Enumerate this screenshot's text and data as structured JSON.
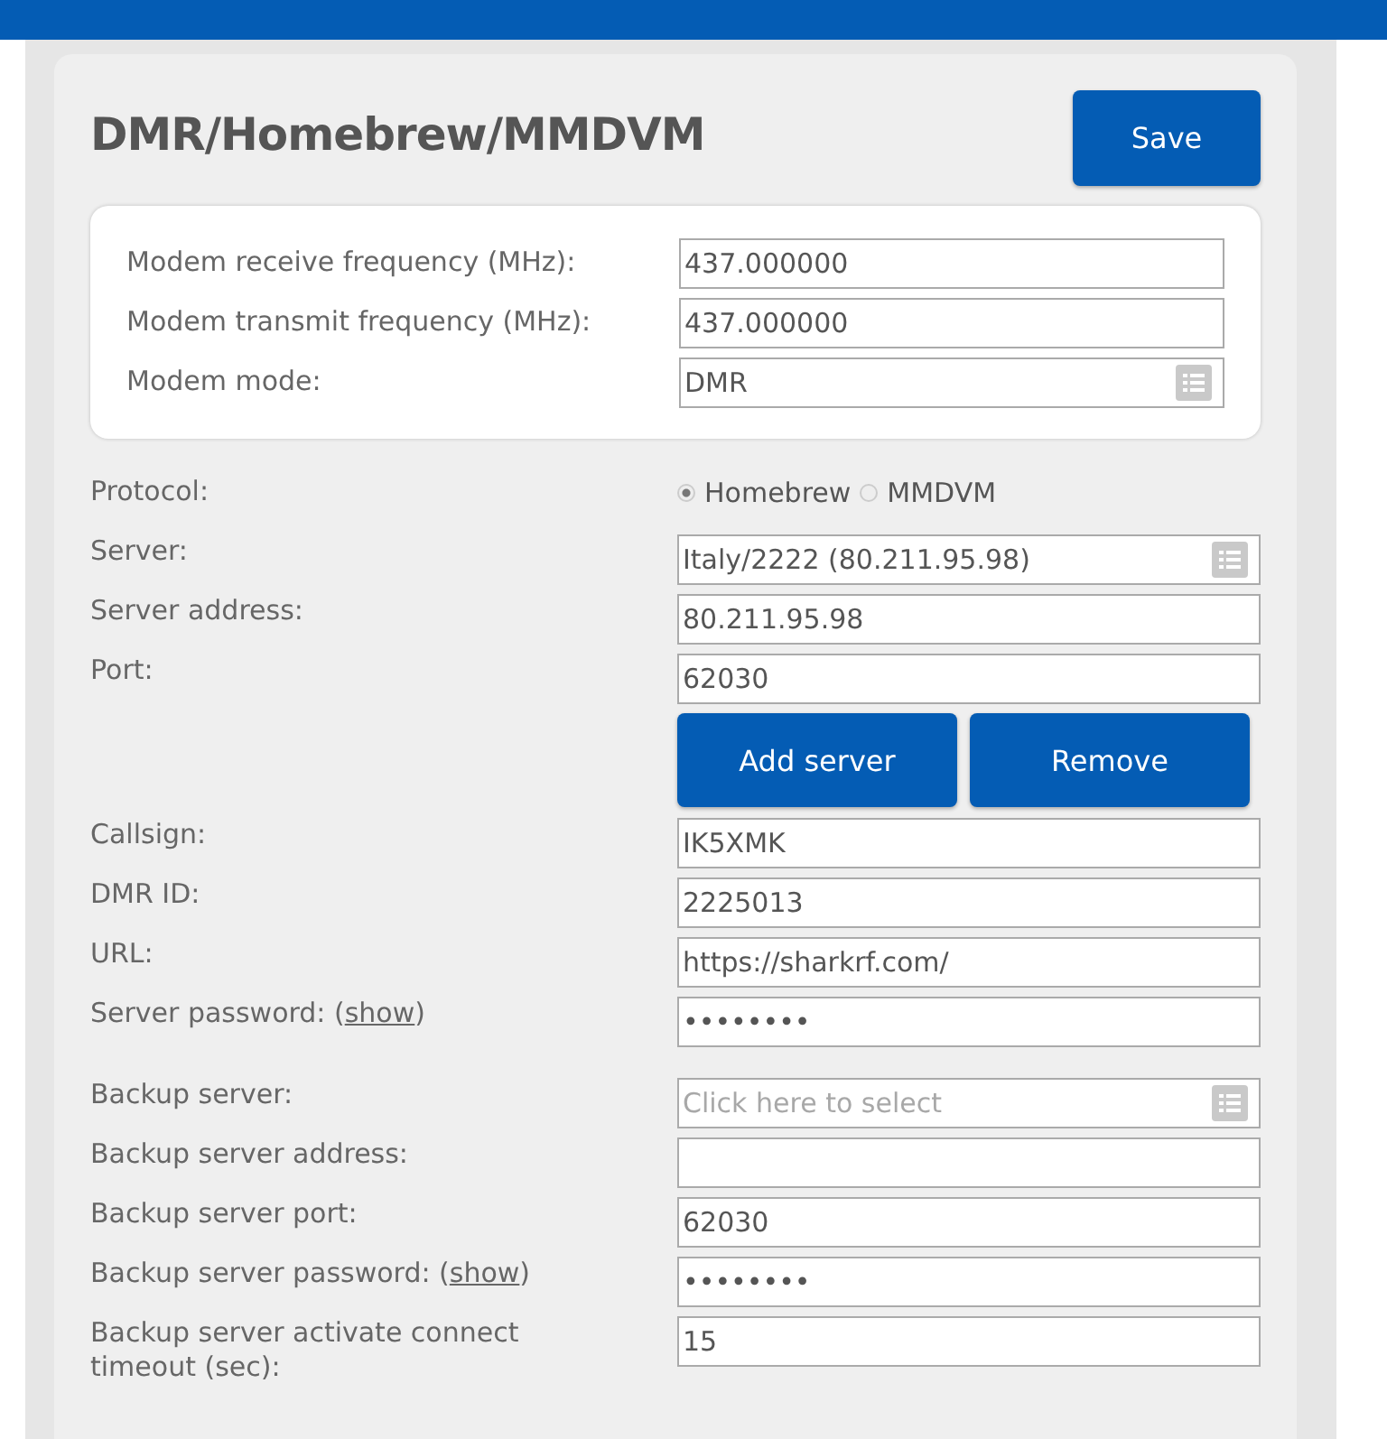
{
  "title": "DMR/Homebrew/MMDVM",
  "save_button": "Save",
  "modem_fields": [
    {
      "kind": "text",
      "label": "Modem receive frequency (MHz):",
      "value": "437.000000"
    },
    {
      "kind": "text",
      "label": "Modem transmit frequency (MHz):",
      "value": "437.000000"
    },
    {
      "kind": "select",
      "label": "Modem mode:",
      "value": "DMR"
    }
  ],
  "fields": [
    {
      "kind": "radio",
      "label": "Protocol:",
      "options": [
        {
          "label": "Homebrew",
          "selected": true
        },
        {
          "label": "MMDVM",
          "selected": false
        }
      ]
    },
    {
      "kind": "select",
      "label": "Server:",
      "value": "Italy/2222 (80.211.95.98)"
    },
    {
      "kind": "text",
      "label": "Server address:",
      "value": "80.211.95.98"
    },
    {
      "kind": "text",
      "label": "Port:",
      "value": "62030"
    },
    {
      "kind": "buttons",
      "buttons": [
        "Add server",
        "Remove"
      ]
    },
    {
      "kind": "text",
      "label": "Callsign:",
      "value": "IK5XMK"
    },
    {
      "kind": "text",
      "label": "DMR ID:",
      "value": "2225013"
    },
    {
      "kind": "text",
      "label": "URL:",
      "value": "https://sharkrf.com/"
    },
    {
      "kind": "password",
      "label": "Server password: (",
      "link": "show",
      "label_end": ")",
      "value": "••••••••"
    },
    {
      "kind": "gap"
    },
    {
      "kind": "select",
      "label": "Backup server:",
      "placeholder": "Click here to select"
    },
    {
      "kind": "text",
      "label": "Backup server address:"
    },
    {
      "kind": "text",
      "label": "Backup server port:",
      "value": "62030"
    },
    {
      "kind": "password",
      "label": "Backup server password: (",
      "link": "show",
      "label_end": ")",
      "value": "••••••••"
    },
    {
      "kind": "text",
      "label": "Backup server activate connect timeout (sec):",
      "value": "15"
    }
  ]
}
